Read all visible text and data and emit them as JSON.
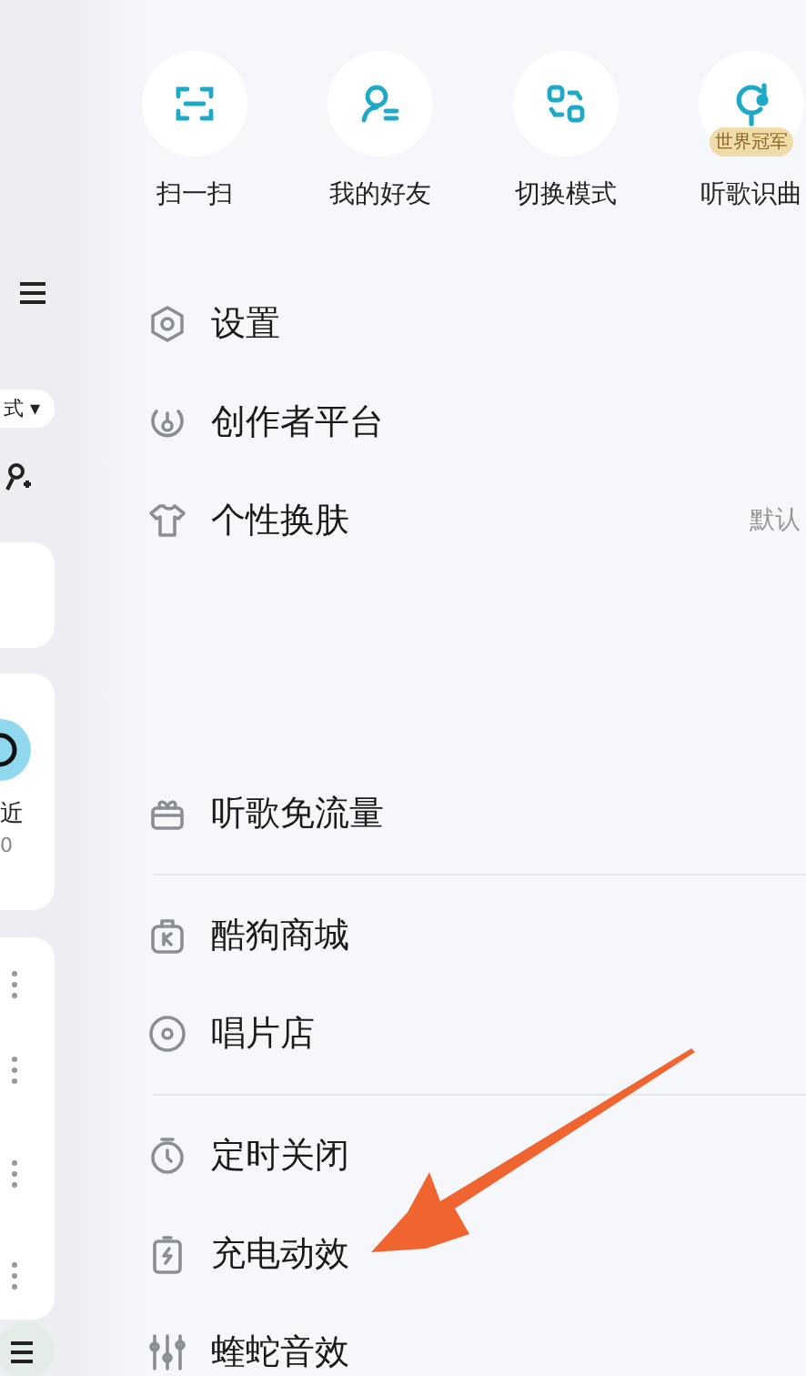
{
  "background_page": {
    "mode_dropdown": "式 ▾",
    "recent_label": "近",
    "recent_count": "0"
  },
  "shortcuts": [
    {
      "label": "扫一扫"
    },
    {
      "label": "我的好友"
    },
    {
      "label": "切换模式"
    },
    {
      "label": "听歌识曲",
      "badge": "世界冠军"
    }
  ],
  "menu_groups": [
    {
      "items": [
        {
          "label": "设置"
        },
        {
          "label": "创作者平台"
        },
        {
          "label": "个性换肤",
          "value": "默认"
        }
      ]
    },
    {
      "items": [
        {
          "label": "听歌免流量"
        }
      ]
    },
    {
      "items": [
        {
          "label": "酷狗商城"
        },
        {
          "label": "唱片店"
        }
      ]
    },
    {
      "items": [
        {
          "label": "定时关闭"
        },
        {
          "label": "充电动效"
        },
        {
          "label": "蝰蛇音效"
        }
      ]
    }
  ]
}
